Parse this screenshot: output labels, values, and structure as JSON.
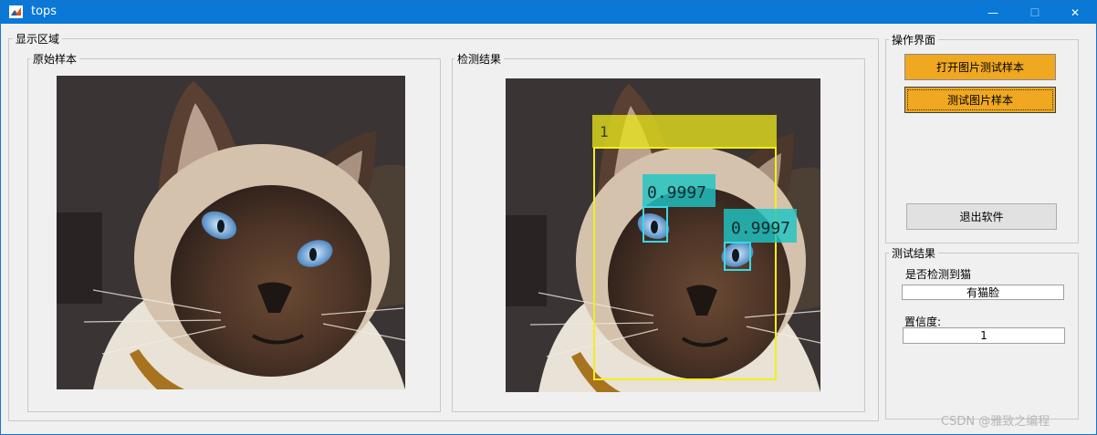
{
  "window": {
    "title": "tops",
    "minimize_glyph": "—",
    "maximize_glyph": "☐",
    "close_glyph": "✕"
  },
  "display_area": {
    "title": "显示区域",
    "original": {
      "title": "原始样本"
    },
    "result": {
      "title": "检测结果",
      "detections": [
        {
          "label": "1",
          "color": "#e7e31c"
        },
        {
          "label": "0.9997",
          "color": "#1ec5c5"
        },
        {
          "label": "0.9997",
          "color": "#1ec5c5"
        }
      ]
    }
  },
  "control_panel": {
    "title": "操作界面",
    "open_button": "打开图片测试样本",
    "test_button": "测试图片样本",
    "exit_button": "退出软件"
  },
  "test_result": {
    "title": "测试结果",
    "detect_label": "是否检测到猫",
    "detect_value": "有猫脸",
    "confidence_label": "置信度:",
    "confidence_value": "1"
  },
  "watermark": "CSDN @雅致之编程"
}
